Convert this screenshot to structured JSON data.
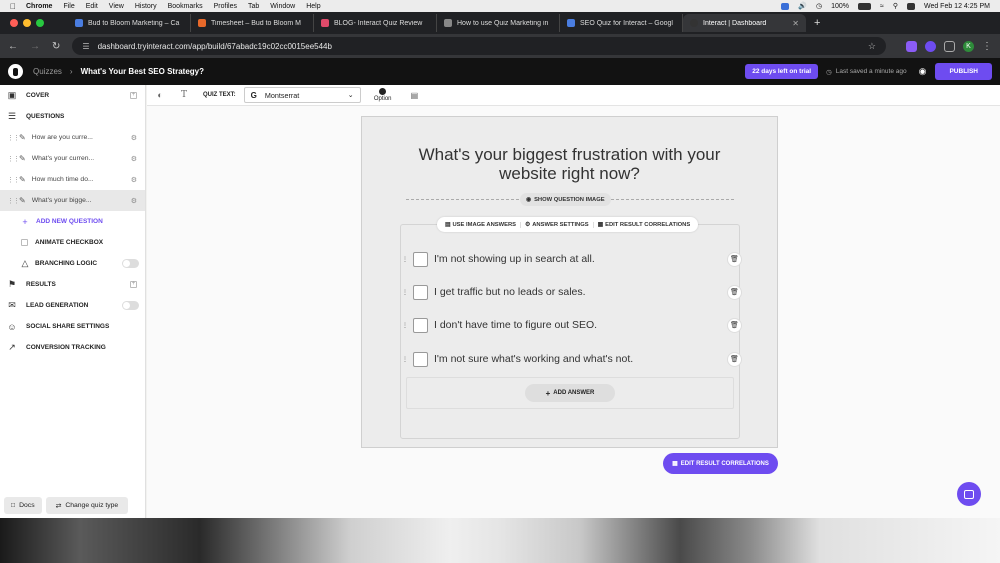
{
  "menubar": {
    "app": "Chrome",
    "items": [
      "File",
      "Edit",
      "View",
      "History",
      "Bookmarks",
      "Profiles",
      "Tab",
      "Window",
      "Help"
    ],
    "battery": "100%",
    "clock": "Wed Feb 12  4:25 PM"
  },
  "browser": {
    "tabs": [
      {
        "label": "Bud to Bloom Marketing – Ca",
        "color": "#4a7de0"
      },
      {
        "label": "Timesheet – Bud to Bloom M",
        "color": "#e8692a"
      },
      {
        "label": "BLOG- Interact Quiz Review",
        "color": "#e04a6a"
      },
      {
        "label": "How to use Quiz Marketing in",
        "color": "#888888"
      },
      {
        "label": "SEO Quiz for Interact – Googl",
        "color": "#4a7de0"
      },
      {
        "label": "Interact | Dashboard",
        "color": "#333333",
        "active": true
      }
    ],
    "url": "dashboard.tryinteract.com/app/build/67abadc19c02cc0015ee544b",
    "profile_initial": "K"
  },
  "header": {
    "crumb_root": "Quizzes",
    "crumb_current": "What's Your Best SEO Strategy?",
    "trial_label": "22 days left on trial",
    "saved_label": "Last saved a minute ago",
    "publish_label": "PUBLISH"
  },
  "sidebar": {
    "cover": "COVER",
    "questions": "QUESTIONS",
    "question_items": [
      {
        "label": "How are you curre..."
      },
      {
        "label": "What's your curren..."
      },
      {
        "label": "How much time do..."
      },
      {
        "label": "What's your bigge...",
        "selected": true
      }
    ],
    "add_question": "ADD NEW QUESTION",
    "animate_checkbox": "ANIMATE CHECKBOX",
    "branching_logic": "BRANCHING LOGIC",
    "results": "RESULTS",
    "lead_generation": "LEAD GENERATION",
    "social_share": "SOCIAL SHARE SETTINGS",
    "conversion_tracking": "CONVERSION TRACKING",
    "docs": "Docs",
    "change_type": "Change quiz type"
  },
  "toolbar": {
    "quiz_text_label": "QUIZ TEXT:",
    "font": "Montserrat",
    "option_label": "Option"
  },
  "editor": {
    "question": "What's your biggest frustration with your website right now?",
    "show_image": "SHOW QUESTION IMAGE",
    "use_image_answers": "USE IMAGE ANSWERS",
    "answer_settings": "ANSWER SETTINGS",
    "edit_result_corr_small": "EDIT RESULT CORRELATIONS",
    "answers": [
      "I'm not showing up in search at all.",
      "I get traffic but no leads or sales.",
      "I don't have time to figure out SEO.",
      "I'm not sure what's working and what's not."
    ],
    "add_answer": "ADD ANSWER",
    "edit_result_corr": "EDIT RESULT CORRELATIONS"
  },
  "colors": {
    "accent": "#6e4cf0"
  }
}
